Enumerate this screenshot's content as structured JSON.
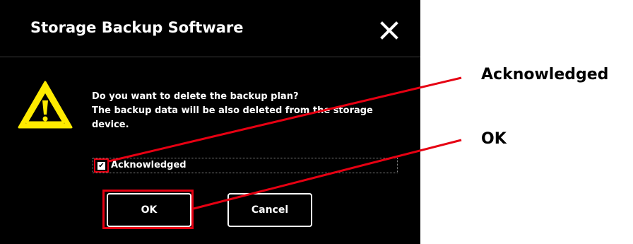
{
  "dialog": {
    "title": "Storage Backup Software",
    "message_lines": [
      "Do you want to delete the backup plan?",
      "The backup data will be also deleted from the storage",
      "device."
    ],
    "acknowledge_label": "Acknowledged",
    "acknowledge_checked": true,
    "ok_label": "OK",
    "cancel_label": "Cancel"
  },
  "callouts": {
    "acknowledged": "Acknowledged",
    "ok": "OK"
  },
  "colors": {
    "dialog_background": "#000000",
    "highlight": "#e60012",
    "warning_yellow": "#ffeb00"
  },
  "icons": {
    "close": "close-icon",
    "warning": "warning-icon",
    "check": "check-icon"
  }
}
